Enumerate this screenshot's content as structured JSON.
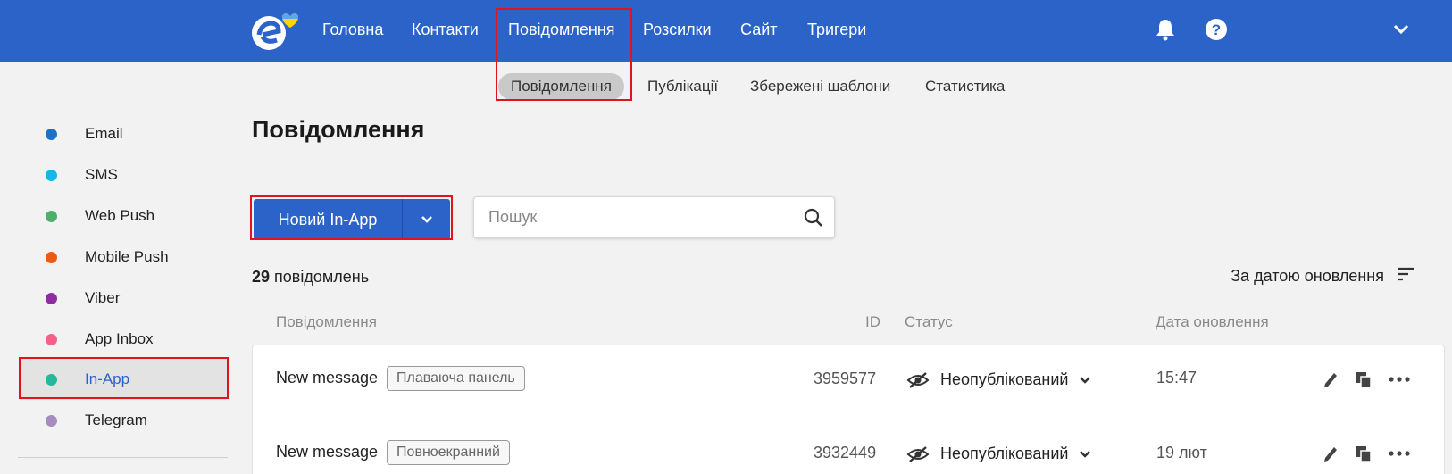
{
  "topnav": {
    "items": [
      "Головна",
      "Контакти",
      "Повідомлення",
      "Розсилки",
      "Сайт",
      "Тригери"
    ],
    "active_index": 2
  },
  "subnav": {
    "items": [
      "Повідомлення",
      "Публікації",
      "Збережені шаблони",
      "Статистика"
    ],
    "active_index": 0
  },
  "sidebar": {
    "items": [
      {
        "label": "Email",
        "color": "#1a73c4"
      },
      {
        "label": "SMS",
        "color": "#19b5ea"
      },
      {
        "label": "Web Push",
        "color": "#4caf6a"
      },
      {
        "label": "Mobile Push",
        "color": "#ee5a14"
      },
      {
        "label": "Viber",
        "color": "#8e2da2"
      },
      {
        "label": "App Inbox",
        "color": "#f4628a"
      },
      {
        "label": "In-App",
        "color": "#25b89c"
      },
      {
        "label": "Telegram",
        "color": "#a58bc0"
      }
    ],
    "active_index": 6
  },
  "main": {
    "title": "Повідомлення",
    "new_button_label": "Новий In-App",
    "search_placeholder": "Пошук",
    "count_number": "29",
    "count_label": "повідомлень",
    "sort_label": "За датою оновлення"
  },
  "table": {
    "headers": {
      "message": "Повідомлення",
      "id": "ID",
      "status": "Статус",
      "updated": "Дата оновлення"
    },
    "rows": [
      {
        "name": "New message",
        "tag": "Плаваюча панель",
        "id": "3959577",
        "status": "Неопублікований",
        "updated": "15:47"
      },
      {
        "name": "New message",
        "tag": "Повноекранний",
        "id": "3932449",
        "status": "Неопублікований",
        "updated": "19 лют"
      }
    ]
  },
  "colors": {
    "accent": "#2c63c9",
    "highlight_border": "#e0141e"
  }
}
